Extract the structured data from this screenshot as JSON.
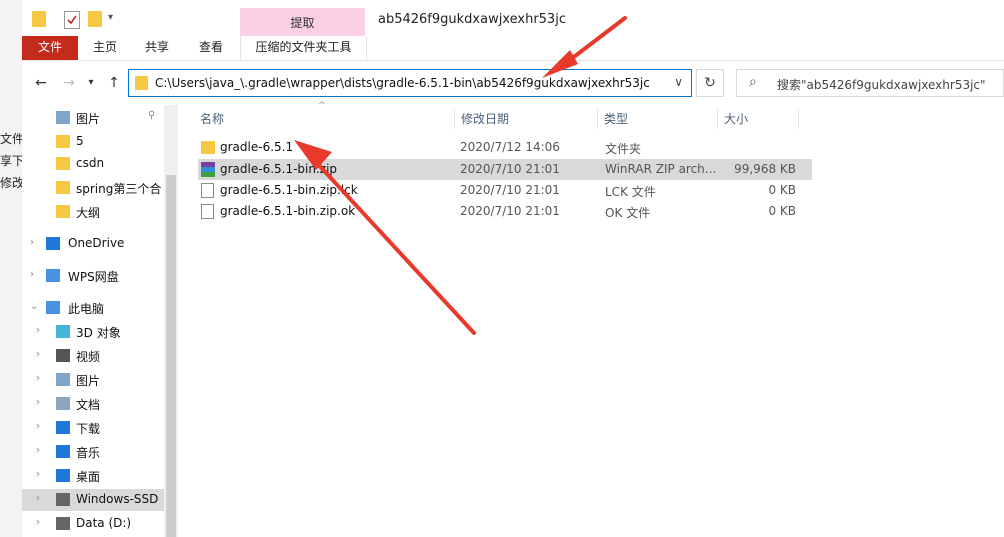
{
  "window": {
    "title": "ab5426f9gukdxawjxexhr53jc",
    "quick_access_separator": "▾"
  },
  "background_window": {
    "fragments": [
      "文件",
      "享下载",
      "修改"
    ]
  },
  "ribbon": {
    "context_group_label": "提取",
    "tabs": [
      "文件",
      "主页",
      "共享",
      "查看",
      "压缩的文件夹工具"
    ]
  },
  "navigation": {
    "back_icon": "←",
    "forward_icon": "→",
    "recent_icon": "▾",
    "up_icon": "↑",
    "address_path": "C:\\Users\\java_\\.gradle\\wrapper\\dists\\gradle-6.5.1-bin\\ab5426f9gukdxawjxexhr53jc",
    "address_dropdown_icon": "∨",
    "refresh_icon": "↻",
    "search_placeholder": "搜索\"ab5426f9gukdxawjxexhr53jc\"",
    "search_icon": "⌕"
  },
  "nav_pane": {
    "items": [
      {
        "label": "图片",
        "icon": "pictures-icon",
        "pinned": true
      },
      {
        "label": "5",
        "icon": "folder-icon"
      },
      {
        "label": "csdn",
        "icon": "folder-icon"
      },
      {
        "label": "spring第三个合",
        "icon": "folder-icon"
      },
      {
        "label": "大纲",
        "icon": "folder-icon"
      },
      {
        "label": "OneDrive",
        "icon": "onedrive-icon",
        "expandable": true
      },
      {
        "label": "WPS网盘",
        "icon": "wps-cloud-icon",
        "expandable": true
      },
      {
        "label": "此电脑",
        "icon": "this-pc-icon",
        "expanded": true
      },
      {
        "label": "3D 对象",
        "icon": "3d-objects-icon",
        "expandable": true
      },
      {
        "label": "视频",
        "icon": "videos-icon",
        "expandable": true
      },
      {
        "label": "图片",
        "icon": "pictures-icon",
        "expandable": true
      },
      {
        "label": "文档",
        "icon": "documents-icon",
        "expandable": true
      },
      {
        "label": "下载",
        "icon": "downloads-icon",
        "expandable": true
      },
      {
        "label": "音乐",
        "icon": "music-icon",
        "expandable": true
      },
      {
        "label": "桌面",
        "icon": "desktop-icon",
        "expandable": true
      },
      {
        "label": "Windows-SSD",
        "icon": "drive-icon",
        "expandable": true,
        "selected": true
      },
      {
        "label": "Data (D:)",
        "icon": "drive-icon",
        "expandable": true
      }
    ]
  },
  "file_list": {
    "columns": [
      "名称",
      "修改日期",
      "类型",
      "大小"
    ],
    "rows": [
      {
        "name": "gradle-6.5.1",
        "date": "2020/7/12 14:06",
        "type": "文件夹",
        "size": "",
        "icon": "folder-icon"
      },
      {
        "name": "gradle-6.5.1-bin.zip",
        "date": "2020/7/10 21:01",
        "type": "WinRAR ZIP arch...",
        "size": "99,968 KB",
        "icon": "winrar-zip-icon",
        "selected": true
      },
      {
        "name": "gradle-6.5.1-bin.zip.lck",
        "date": "2020/7/10 21:01",
        "type": "LCK 文件",
        "size": "0 KB",
        "icon": "file-icon"
      },
      {
        "name": "gradle-6.5.1-bin.zip.ok",
        "date": "2020/7/10 21:01",
        "type": "OK 文件",
        "size": "0 KB",
        "icon": "file-icon"
      }
    ]
  },
  "colors": {
    "file_tab": "#c42b1c",
    "context_tab": "#fbd0e4",
    "address_border": "#0078d7",
    "selected_row": "#d9d9d9",
    "annotation_arrow": "#e8392b",
    "folder": "#f5c842"
  }
}
